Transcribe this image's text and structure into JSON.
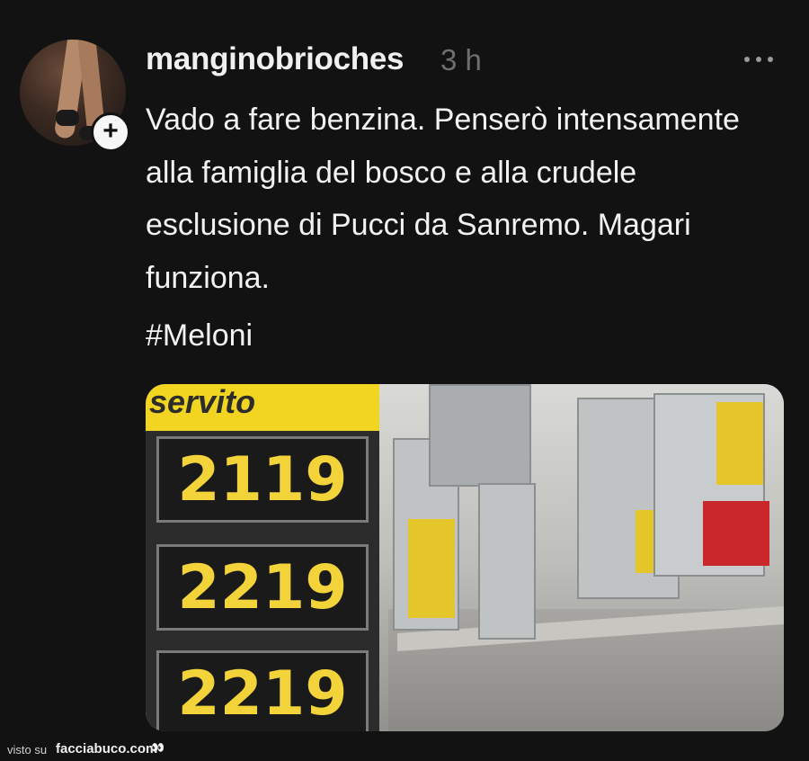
{
  "post": {
    "username": "manginobrioches",
    "time": "3 h",
    "text": "Vado a fare benzina. Penserò intensamente alla famiglia del bosco e alla crudele esclusione di Pucci da Sanremo. Magari funziona.",
    "hashtag": "#Meloni",
    "follow_symbol": "+",
    "more_icon": "more-dots-icon"
  },
  "photo": {
    "brand_text": "servito",
    "prices": [
      "2119",
      "2219",
      "2219"
    ]
  },
  "footer": {
    "visto_label": "visto su",
    "site_label": "facciabuco.com",
    "eyes_glyph": "👀"
  }
}
